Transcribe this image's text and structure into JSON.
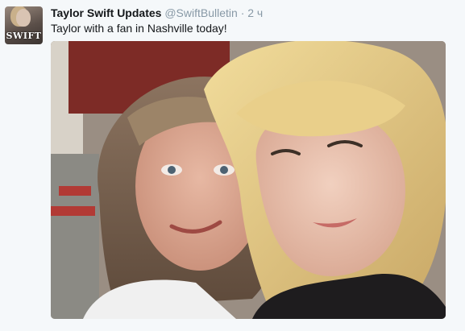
{
  "tweet": {
    "author_name": "Taylor Swift Updates",
    "handle": "@SwiftBulletin",
    "separator": "·",
    "time": "2 ч",
    "text": "Taylor with a fan in Nashville today!",
    "avatar_text": "SWIFT"
  },
  "colors": {
    "background": "#f5f8fa",
    "name": "#14171a",
    "meta": "#8899a6",
    "text": "#14171a"
  },
  "icons": {
    "avatar": "profile-avatar",
    "photo": "tweet-photo"
  }
}
